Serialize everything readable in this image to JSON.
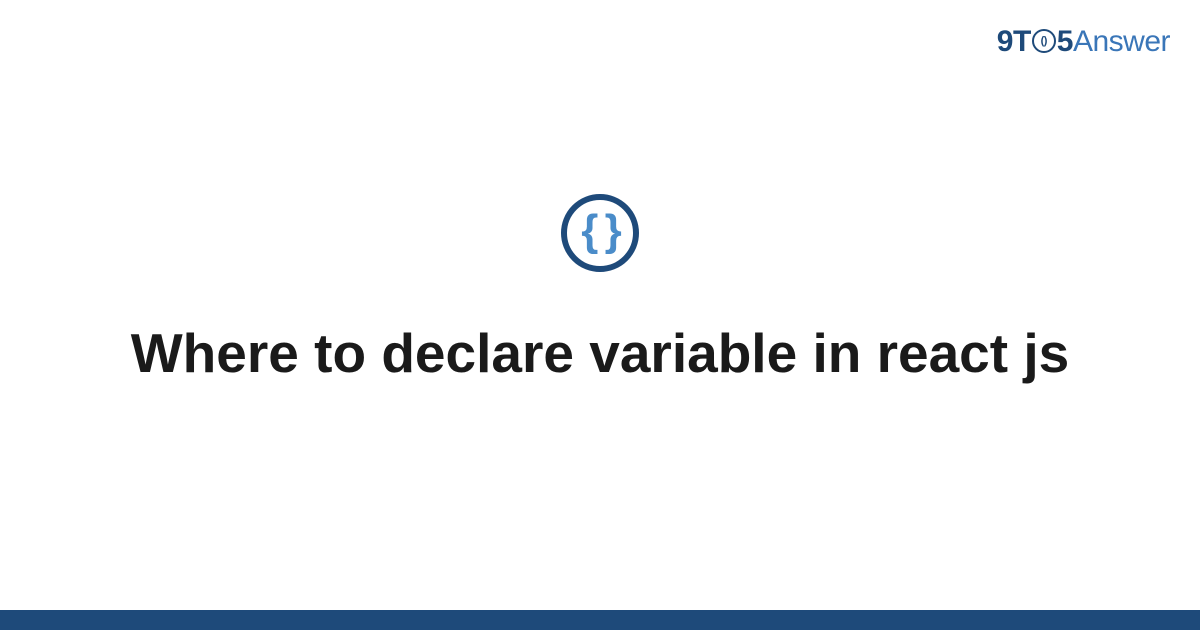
{
  "logo": {
    "nine": "9",
    "t": "T",
    "clock_label": "()",
    "five": "5",
    "answer": "Answer"
  },
  "badge": {
    "icon_text": "{ }"
  },
  "title": "Where to declare variable in react js"
}
